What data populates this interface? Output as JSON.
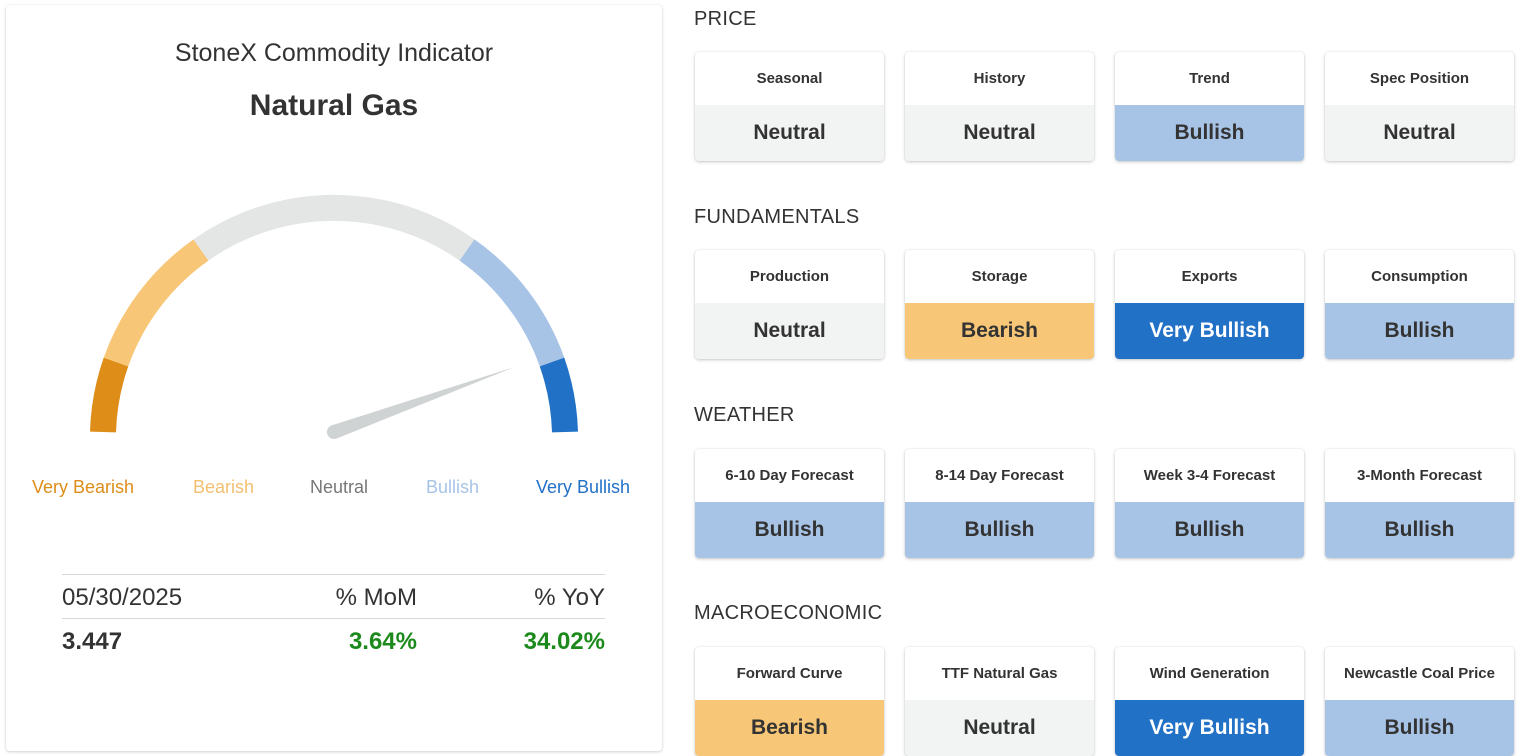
{
  "indicator": {
    "title": "StoneX Commodity Indicator",
    "commodity": "Natural Gas",
    "scale": {
      "labels": [
        "Very Bearish",
        "Bearish",
        "Neutral",
        "Bullish",
        "Very Bullish"
      ],
      "colors": [
        "#dd8d18",
        "#f7c676",
        "#e4e6e6",
        "#a7c4e7",
        "#2171c7"
      ],
      "label_colors": [
        "#dd8d18",
        "#f3c071",
        "#777777",
        "#a7c4e7",
        "#2171c7"
      ]
    },
    "needle_reading_fraction": 0.89,
    "stats": {
      "date": "05/30/2025",
      "mom_label": "% MoM",
      "yoy_label": "% YoY",
      "price": "3.447",
      "mom_value": "3.64%",
      "yoy_value": "34.02%"
    }
  },
  "sections": [
    {
      "title": "PRICE",
      "tiles": [
        {
          "label": "Seasonal",
          "status": "Neutral"
        },
        {
          "label": "History",
          "status": "Neutral"
        },
        {
          "label": "Trend",
          "status": "Bullish"
        },
        {
          "label": "Spec Position",
          "status": "Neutral"
        }
      ]
    },
    {
      "title": "FUNDAMENTALS",
      "tiles": [
        {
          "label": "Production",
          "status": "Neutral"
        },
        {
          "label": "Storage",
          "status": "Bearish"
        },
        {
          "label": "Exports",
          "status": "Very Bullish"
        },
        {
          "label": "Consumption",
          "status": "Bullish"
        }
      ]
    },
    {
      "title": "WEATHER",
      "tiles": [
        {
          "label": "6-10 Day Forecast",
          "status": "Bullish"
        },
        {
          "label": "8-14 Day Forecast",
          "status": "Bullish"
        },
        {
          "label": "Week 3-4 Forecast",
          "status": "Bullish"
        },
        {
          "label": "3-Month Forecast",
          "status": "Bullish"
        }
      ]
    },
    {
      "title": "MACROECONOMIC",
      "tiles": [
        {
          "label": "Forward Curve",
          "status": "Bearish"
        },
        {
          "label": "TTF Natural Gas",
          "status": "Neutral"
        },
        {
          "label": "Wind Generation",
          "status": "Very Bullish"
        },
        {
          "label": "Newcastle Coal Price",
          "status": "Bullish"
        }
      ]
    }
  ]
}
